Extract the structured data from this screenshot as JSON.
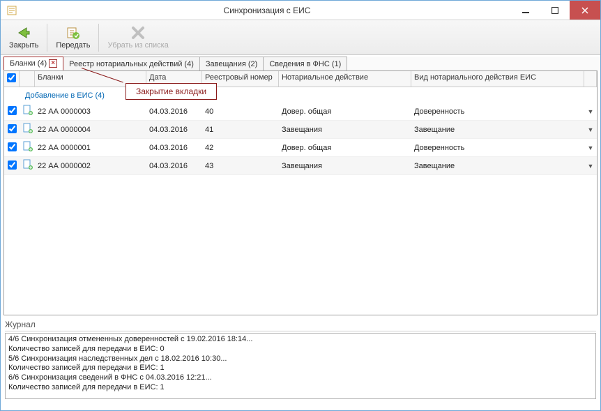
{
  "window": {
    "title": "Синхронизация с ЕИС"
  },
  "toolbar": {
    "close": "Закрыть",
    "send": "Передать",
    "remove": "Убрать из списка"
  },
  "tabs": [
    {
      "label": "Бланки (4)",
      "active": true,
      "closable": true
    },
    {
      "label": "Реестр нотариальных действий (4)"
    },
    {
      "label": "Завещания (2)"
    },
    {
      "label": "Сведения в ФНС (1)"
    }
  ],
  "columns": {
    "blank": "Бланки",
    "date": "Дата",
    "reg": "Реестровый номер",
    "act": "Нотариальное действие",
    "type": "Вид нотариального действия ЕИС"
  },
  "group": "Добавление в ЕИС (4)",
  "rows": [
    {
      "blank": "22 АА 0000003",
      "date": "04.03.2016",
      "reg": "40",
      "act": "Довер. общая",
      "type": "Доверенность"
    },
    {
      "blank": "22 АА 0000004",
      "date": "04.03.2016",
      "reg": "41",
      "act": "Завещания",
      "type": "Завещание"
    },
    {
      "blank": "22 АА 0000001",
      "date": "04.03.2016",
      "reg": "42",
      "act": "Довер. общая",
      "type": "Доверенность"
    },
    {
      "blank": "22 АА 0000002",
      "date": "04.03.2016",
      "reg": "43",
      "act": "Завещания",
      "type": "Завещание"
    }
  ],
  "annotation": "Закрытие вкладки",
  "journal_title": "Журнал",
  "journal": [
    "4/6 Синхронизация отмененных доверенностей с 19.02.2016 18:14...",
    "   Количество записей для передачи в ЕИС: 0",
    "5/6 Синхронизация наследственных дел с 18.02.2016 10:30...",
    "   Количество записей для передачи в ЕИС: 1",
    "6/6 Синхронизация сведений в ФНС с 04.03.2016 12:21...",
    "   Количество записей для передачи в ЕИС: 1"
  ]
}
